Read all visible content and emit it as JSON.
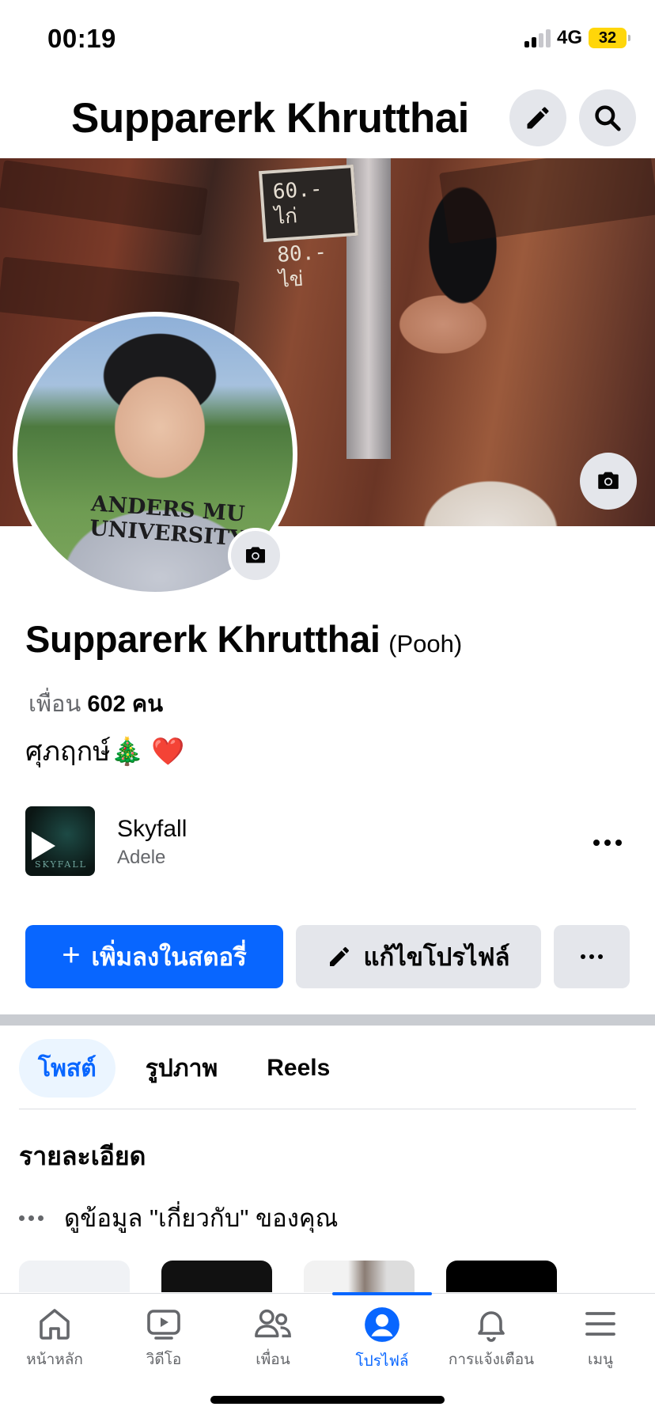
{
  "status_bar": {
    "time": "00:19",
    "network": "4G",
    "battery": "32"
  },
  "header": {
    "title": "Supparerk Khrutthai"
  },
  "cover": {
    "sign_line1": "60.- ไก่",
    "sign_line2": "80.- ไข่"
  },
  "avatar": {
    "shirt_text": "ANDERS MU UNIVERSITY"
  },
  "profile": {
    "name": "Supparerk Khrutthai",
    "alt_name": "(Pooh)",
    "friends_prefix": "เพื่อน",
    "friends_count": "602",
    "friends_suffix": "คน",
    "bio": "ศุภฤกษ์🎄 ❤️"
  },
  "music": {
    "title": "Skyfall",
    "artist": "Adele",
    "art_label": "SKYFALL"
  },
  "actions": {
    "add_story": "เพิ่มลงในสตอรี่",
    "edit_profile": "แก้ไขโปรไฟล์"
  },
  "tabs": [
    {
      "label": "โพสต์",
      "active": true
    },
    {
      "label": "รูปภาพ",
      "active": false
    },
    {
      "label": "Reels",
      "active": false
    }
  ],
  "details": {
    "title": "รายละเอียด",
    "about_link": "ดูข้อมูล \"เกี่ยวกับ\" ของคุณ"
  },
  "nav": [
    {
      "label": "หน้าหลัก",
      "icon": "home-icon",
      "active": false
    },
    {
      "label": "วิดีโอ",
      "icon": "video-icon",
      "active": false
    },
    {
      "label": "เพื่อน",
      "icon": "friends-icon",
      "active": false
    },
    {
      "label": "โปรไฟล์",
      "icon": "profile-icon",
      "active": true
    },
    {
      "label": "การแจ้งเตือน",
      "icon": "bell-icon",
      "active": false
    },
    {
      "label": "เมนู",
      "icon": "menu-icon",
      "active": false
    }
  ],
  "colors": {
    "accent": "#0866ff",
    "secondary_button": "#e4e6eb",
    "muted_text": "#65676b"
  }
}
